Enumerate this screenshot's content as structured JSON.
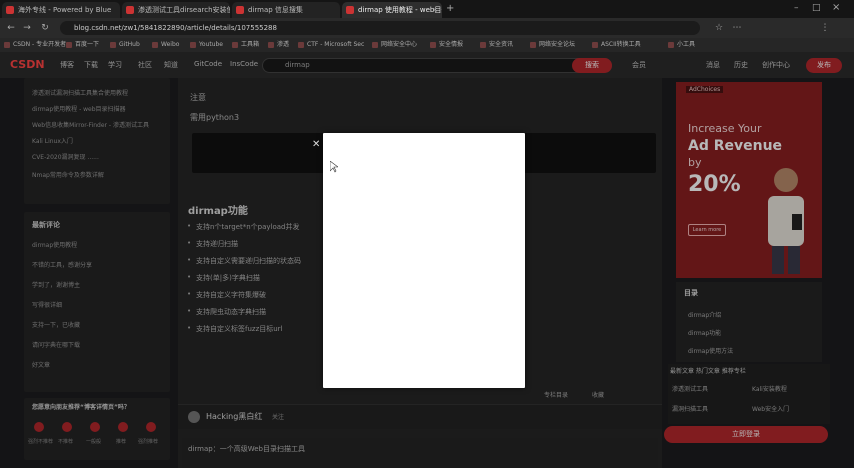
{
  "browser": {
    "tabs": [
      {
        "label": "海外专线 - Powered by Blue",
        "active": false
      },
      {
        "label": "渗透测试工具dirsearch安装使用",
        "active": false
      },
      {
        "label": "dirmap 信息搜集",
        "active": false
      },
      {
        "label": "dirmap 使用教程 - web目录扫描",
        "active": true
      }
    ],
    "url": "blog.csdn.net/zw1/5841822890/article/details/107555288",
    "bookmarks": [
      "CSDN - 专业开发者",
      "百度一下",
      "GitHub",
      "Weibo",
      "Youtube",
      "工具箱",
      "渗透",
      "CTF - Microsoft Sec",
      "网络安全中心",
      "安全情报",
      "安全资讯",
      "网络安全论坛",
      "ASCII转换工具",
      "小工具"
    ]
  },
  "header": {
    "logo": "CSDN",
    "nav": [
      "博客",
      "下载",
      "学习",
      "社区",
      "知道",
      "GitCode",
      "InsCode"
    ],
    "search_placeholder": "dirmap",
    "search_button": "搜索",
    "links": [
      "会员",
      "消息",
      "历史",
      "创作中心"
    ],
    "publish": "发布"
  },
  "left": {
    "recent": [
      "渗透测试漏洞扫描工具集合使用教程",
      "dirmap使用教程 - web目录扫描器",
      "Web信息收集Mirror-Finder - 渗透测试工具",
      "Kali Linux入门",
      "CVE-2020漏洞复现 ......",
      "Nmap常用命令及参数详解"
    ],
    "comments_title": "最新评论",
    "comments": [
      "dirmap使用教程",
      "不错的工具，感谢分享",
      "学到了，谢谢博主",
      "写得很详细",
      "支持一下，已收藏",
      "请问字典在哪下载",
      "好文章"
    ],
    "vote_title": "您愿意向朋友推荐“博客详情页”吗？",
    "vote_options": [
      "强烈不推荐",
      "不推荐",
      "一般般",
      "推荐",
      "强烈推荐"
    ]
  },
  "article": {
    "note": "注意",
    "note2": "需用python3",
    "section_title": "dirmap功能",
    "bullets": [
      "支持n个target*n个payload并发",
      "支持递归扫描",
      "支持自定义需要递归扫描的状态码",
      "支持(单|多)字典扫描",
      "支持自定义字符集爆破",
      "支持爬虫动态字典扫描",
      "支持自定义标签fuzz目标url"
    ],
    "author": "Hacking黑白红",
    "author_badge": "关注",
    "actions": [
      "专栏目录",
      "收藏"
    ],
    "next_title": "dirmap：一个高级Web目录扫描工具"
  },
  "right": {
    "ad_label": "AdChoices",
    "ad_line1": "Increase Your",
    "ad_line2": "Ad Revenue",
    "ad_line3": "by",
    "ad_line4": "20%",
    "ad_button": "Learn more",
    "toc_title": "目录",
    "toc_items": [
      "dirmap介绍",
      "dirmap功能",
      "dirmap使用方法"
    ],
    "related_title": "最新文章 热门文章 推荐专栏",
    "related_items": [
      "渗透测试工具",
      "Kali安装教程",
      "漏洞扫描工具",
      "Web安全入门"
    ],
    "login_button": "立即登录"
  },
  "colors": {
    "brand": "#fc5531",
    "ad_bg": "#8a1f21",
    "modal_bg": "#ffffff"
  }
}
